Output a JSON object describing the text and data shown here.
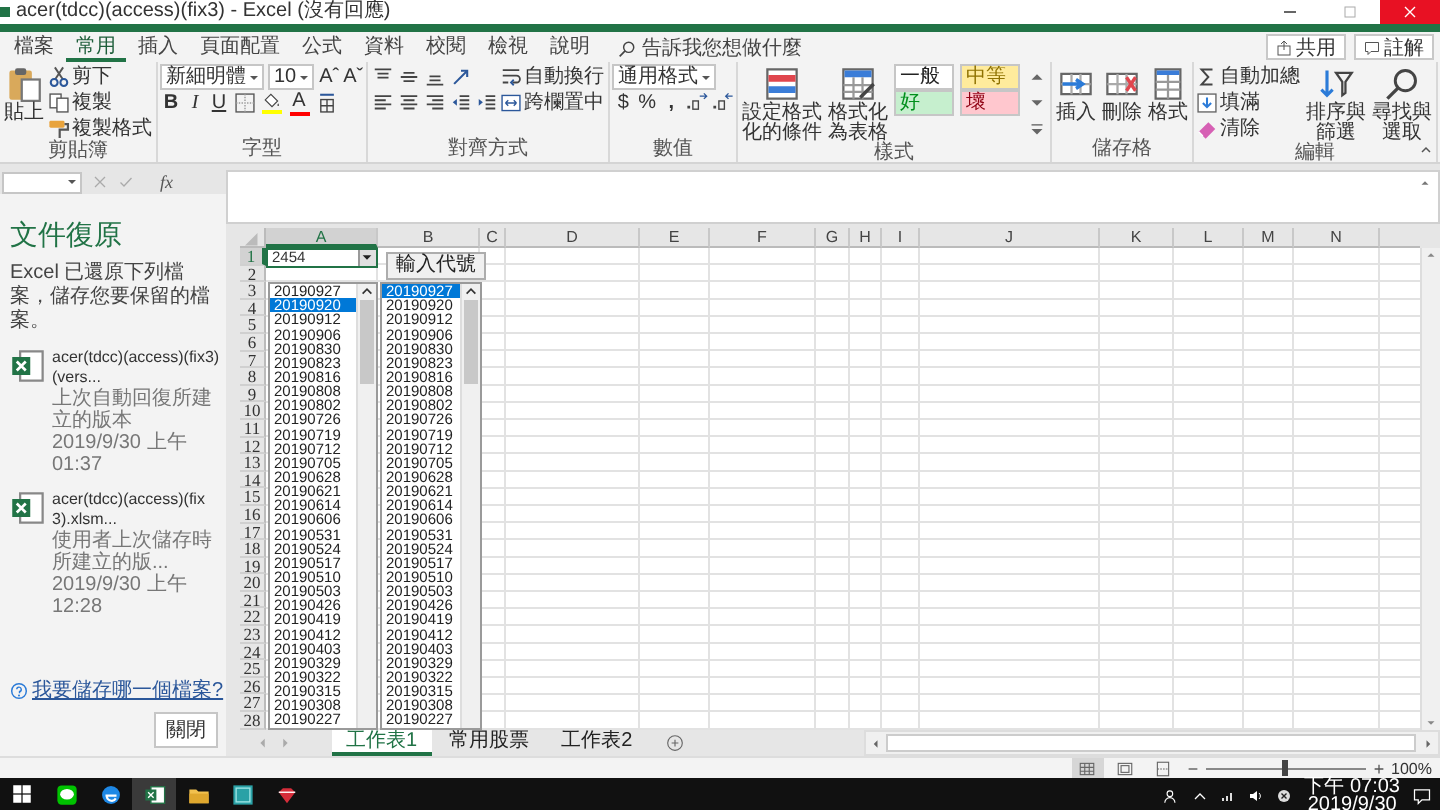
{
  "window": {
    "title": "acer(tdcc)(access)(fix3) - Excel (沒有回應)"
  },
  "ribbon_tabs": [
    {
      "label": "檔案",
      "selected": false
    },
    {
      "label": "常用",
      "selected": true
    },
    {
      "label": "插入",
      "selected": false
    },
    {
      "label": "頁面配置",
      "selected": false
    },
    {
      "label": "公式",
      "selected": false
    },
    {
      "label": "資料",
      "selected": false
    },
    {
      "label": "校閱",
      "selected": false
    },
    {
      "label": "檢視",
      "selected": false
    },
    {
      "label": "說明",
      "selected": false
    }
  ],
  "tell_me": {
    "placeholder": "告訴我您想做什麼"
  },
  "share_button": {
    "label": "共用"
  },
  "comments_button": {
    "label": "註解"
  },
  "ribbon_groups": [
    {
      "label": "剪貼簿",
      "columns": [
        [
          [
            {
              "kind": "large",
              "label": "貼上"
            }
          ]
        ],
        [
          [
            {
              "kind": "small",
              "label": "剪下"
            }
          ],
          [
            {
              "kind": "small",
              "label": "複製"
            }
          ],
          [
            {
              "kind": "small",
              "label": "複製格式"
            }
          ]
        ]
      ]
    },
    {
      "label": "字型",
      "columns": [
        [
          [
            {
              "kind": "field",
              "value": "新細明體"
            },
            {
              "kind": "field",
              "value": "10"
            },
            {
              "kind": "glyph",
              "label": "Aˆ"
            },
            {
              "kind": "glyph",
              "label": "Aˇ"
            }
          ],
          [
            {
              "kind": "bold",
              "label": "B"
            },
            {
              "kind": "italic",
              "label": "I"
            },
            {
              "kind": "underline",
              "label": "U"
            },
            {
              "kind": "icon"
            },
            {
              "kind": "swatch",
              "color": "#ffff00"
            },
            {
              "kind": "swatch",
              "label": "A",
              "color": "#ff0000"
            },
            {
              "kind": "icon"
            }
          ]
        ]
      ]
    },
    {
      "label": "對齊方式",
      "columns": [
        [
          [
            {
              "kind": "icon"
            },
            {
              "kind": "icon"
            },
            {
              "kind": "icon"
            },
            {
              "kind": "icon"
            }
          ],
          [
            {
              "kind": "icon"
            },
            {
              "kind": "icon"
            },
            {
              "kind": "icon"
            },
            {
              "kind": "icon"
            },
            {
              "kind": "icon"
            }
          ]
        ],
        [
          [
            {
              "kind": "small",
              "label": "自動換行"
            }
          ],
          [
            {
              "kind": "small",
              "label": "跨欄置中"
            }
          ]
        ]
      ]
    },
    {
      "label": "數值",
      "columns": [
        [
          [
            {
              "kind": "field",
              "value": "通用格式"
            }
          ],
          [
            {
              "kind": "glyph",
              "label": "$"
            },
            {
              "kind": "glyph",
              "label": "%"
            },
            {
              "kind": "bold",
              "label": ","
            },
            {
              "kind": "icon"
            },
            {
              "kind": "icon"
            }
          ]
        ]
      ]
    },
    {
      "label": "樣式",
      "columns": [
        [
          [
            {
              "kind": "large",
              "label": "設定格式化的條件"
            }
          ]
        ],
        [
          [
            {
              "kind": "large",
              "label": "格式化為表格"
            }
          ]
        ],
        [
          [
            {
              "kind": "style",
              "label": "一般",
              "color": "#ffffff"
            },
            {
              "kind": "style",
              "label": "中等",
              "color": "#ffeb9c"
            }
          ],
          [
            {
              "kind": "style",
              "label": "好",
              "color": "#c6efce"
            },
            {
              "kind": "style",
              "label": "壞",
              "color": "#ffc7ce"
            }
          ]
        ],
        [
          [
            {
              "kind": "icon"
            }
          ],
          [
            {
              "kind": "icon"
            }
          ],
          [
            {
              "kind": "icon"
            }
          ]
        ]
      ]
    },
    {
      "label": "儲存格",
      "columns": [
        [
          [
            {
              "kind": "large",
              "label": "插入"
            }
          ]
        ],
        [
          [
            {
              "kind": "large",
              "label": "刪除"
            }
          ]
        ],
        [
          [
            {
              "kind": "large",
              "label": "格式"
            }
          ]
        ]
      ]
    },
    {
      "label": "編輯",
      "columns": [
        [
          [
            {
              "kind": "small",
              "label": "自動加總"
            }
          ],
          [
            {
              "kind": "small",
              "label": "填滿"
            }
          ],
          [
            {
              "kind": "small",
              "label": "清除"
            }
          ]
        ],
        [
          [
            {
              "kind": "large",
              "label": "排序與篩選"
            }
          ]
        ],
        [
          [
            {
              "kind": "large",
              "label": "尋找與選取"
            }
          ]
        ]
      ]
    }
  ],
  "formula_bar": {
    "function_label": "fx"
  },
  "recovery_pane": {
    "title": "文件復原",
    "description": "Excel 已還原下列檔案，儲存您要保留的檔案。",
    "files": [
      {
        "name": "acer(tdcc)(access)(fix3) (vers...",
        "description": "上次自動回復所建立的版本",
        "time": "2019/9/30 上午 01:37"
      },
      {
        "name": "acer(tdcc)(access)(fix3).xlsm...",
        "description": "使用者上次儲存時所建立的版...",
        "time": "2019/9/30 上午 12:28"
      }
    ],
    "help_link": "我要儲存哪一個檔案?",
    "close_button": "關閉"
  },
  "sheet": {
    "columns": [
      {
        "label": "A",
        "selected": true
      },
      {
        "label": "B",
        "selected": false
      },
      {
        "label": "C",
        "selected": false
      },
      {
        "label": "D",
        "selected": false
      },
      {
        "label": "E",
        "selected": false
      },
      {
        "label": "F",
        "selected": false
      },
      {
        "label": "G",
        "selected": false
      },
      {
        "label": "H",
        "selected": false
      },
      {
        "label": "I",
        "selected": false
      },
      {
        "label": "J",
        "selected": false
      },
      {
        "label": "K",
        "selected": false
      },
      {
        "label": "L",
        "selected": false
      },
      {
        "label": "M",
        "selected": false
      },
      {
        "label": "N",
        "selected": false
      }
    ],
    "rows": [
      {
        "label": "1",
        "selected": true
      },
      {
        "label": "2",
        "selected": false
      },
      {
        "label": "3",
        "selected": false
      },
      {
        "label": "4",
        "selected": false
      },
      {
        "label": "5",
        "selected": false
      },
      {
        "label": "6",
        "selected": false
      },
      {
        "label": "7",
        "selected": false
      },
      {
        "label": "8",
        "selected": false
      },
      {
        "label": "9",
        "selected": false
      },
      {
        "label": "10",
        "selected": false
      },
      {
        "label": "11",
        "selected": false
      },
      {
        "label": "12",
        "selected": false
      },
      {
        "label": "13",
        "selected": false
      },
      {
        "label": "14",
        "selected": false
      },
      {
        "label": "15",
        "selected": false
      },
      {
        "label": "16",
        "selected": false
      },
      {
        "label": "17",
        "selected": false
      },
      {
        "label": "18",
        "selected": false
      },
      {
        "label": "19",
        "selected": false
      },
      {
        "label": "20",
        "selected": false
      },
      {
        "label": "21",
        "selected": false
      },
      {
        "label": "22",
        "selected": false
      },
      {
        "label": "23",
        "selected": false
      },
      {
        "label": "24",
        "selected": false
      },
      {
        "label": "25",
        "selected": false
      },
      {
        "label": "26",
        "selected": false
      },
      {
        "label": "27",
        "selected": false
      },
      {
        "label": "28",
        "selected": false
      }
    ],
    "combo_box": {
      "value": "2454"
    },
    "button": {
      "label": "輸入代號"
    },
    "list_boxes": [
      {
        "items": [
          {
            "text": "20190927",
            "selected": false
          },
          {
            "text": "20190920",
            "selected": true
          },
          {
            "text": "20190912",
            "selected": false
          },
          {
            "text": "20190906",
            "selected": false
          },
          {
            "text": "20190830",
            "selected": false
          },
          {
            "text": "20190823",
            "selected": false
          },
          {
            "text": "20190816",
            "selected": false
          },
          {
            "text": "20190808",
            "selected": false
          },
          {
            "text": "20190802",
            "selected": false
          },
          {
            "text": "20190726",
            "selected": false
          },
          {
            "text": "20190719",
            "selected": false
          },
          {
            "text": "20190712",
            "selected": false
          },
          {
            "text": "20190705",
            "selected": false
          },
          {
            "text": "20190628",
            "selected": false
          },
          {
            "text": "20190621",
            "selected": false
          },
          {
            "text": "20190614",
            "selected": false
          },
          {
            "text": "20190606",
            "selected": false
          },
          {
            "text": "20190531",
            "selected": false
          },
          {
            "text": "20190524",
            "selected": false
          },
          {
            "text": "20190517",
            "selected": false
          },
          {
            "text": "20190510",
            "selected": false
          },
          {
            "text": "20190503",
            "selected": false
          },
          {
            "text": "20190426",
            "selected": false
          },
          {
            "text": "20190419",
            "selected": false
          },
          {
            "text": "20190412",
            "selected": false
          },
          {
            "text": "20190403",
            "selected": false
          },
          {
            "text": "20190329",
            "selected": false
          },
          {
            "text": "20190322",
            "selected": false
          },
          {
            "text": "20190315",
            "selected": false
          },
          {
            "text": "20190308",
            "selected": false
          },
          {
            "text": "20190227",
            "selected": false
          }
        ]
      },
      {
        "items": [
          {
            "text": "20190927",
            "selected": true
          },
          {
            "text": "20190920",
            "selected": false
          },
          {
            "text": "20190912",
            "selected": false
          },
          {
            "text": "20190906",
            "selected": false
          },
          {
            "text": "20190830",
            "selected": false
          },
          {
            "text": "20190823",
            "selected": false
          },
          {
            "text": "20190816",
            "selected": false
          },
          {
            "text": "20190808",
            "selected": false
          },
          {
            "text": "20190802",
            "selected": false
          },
          {
            "text": "20190726",
            "selected": false
          },
          {
            "text": "20190719",
            "selected": false
          },
          {
            "text": "20190712",
            "selected": false
          },
          {
            "text": "20190705",
            "selected": false
          },
          {
            "text": "20190628",
            "selected": false
          },
          {
            "text": "20190621",
            "selected": false
          },
          {
            "text": "20190614",
            "selected": false
          },
          {
            "text": "20190606",
            "selected": false
          },
          {
            "text": "20190531",
            "selected": false
          },
          {
            "text": "20190524",
            "selected": false
          },
          {
            "text": "20190517",
            "selected": false
          },
          {
            "text": "20190510",
            "selected": false
          },
          {
            "text": "20190503",
            "selected": false
          },
          {
            "text": "20190426",
            "selected": false
          },
          {
            "text": "20190419",
            "selected": false
          },
          {
            "text": "20190412",
            "selected": false
          },
          {
            "text": "20190403",
            "selected": false
          },
          {
            "text": "20190329",
            "selected": false
          },
          {
            "text": "20190322",
            "selected": false
          },
          {
            "text": "20190315",
            "selected": false
          },
          {
            "text": "20190308",
            "selected": false
          },
          {
            "text": "20190227",
            "selected": false
          }
        ]
      }
    ]
  },
  "sheet_tabs": [
    {
      "label": "工作表1",
      "selected": true
    },
    {
      "label": "常用股票",
      "selected": false
    },
    {
      "label": "工作表2",
      "selected": false
    }
  ],
  "status_bar": {
    "views": [
      {
        "selected": true
      },
      {
        "selected": false
      },
      {
        "selected": false
      }
    ],
    "zoom": {
      "level": 0.5,
      "reading": "100%"
    }
  },
  "taskbar": {
    "apps": [
      {
        "active": false
      },
      {
        "active": false
      },
      {
        "active": true
      },
      {
        "active": false
      },
      {
        "active": false
      },
      {
        "active": false
      }
    ],
    "clock": {
      "time": "下午 07:03",
      "date": "2019/9/30"
    }
  }
}
